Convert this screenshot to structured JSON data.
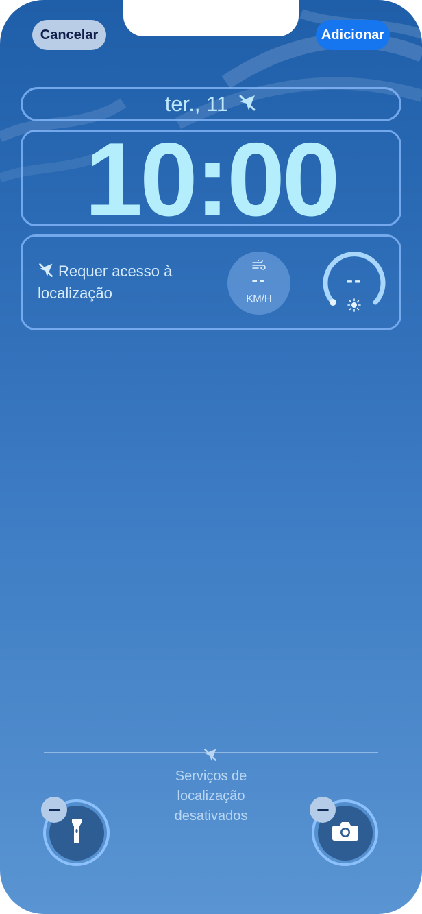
{
  "header": {
    "cancel_label": "Cancelar",
    "add_label": "Adicionar"
  },
  "lock_screen": {
    "date": "ter., 11",
    "time": "10:00"
  },
  "widgets": {
    "location_required": "Requer acesso à localização",
    "wind": {
      "value": "--",
      "unit": "KM/H"
    },
    "uv_gauge": {
      "value": "--"
    }
  },
  "bottom": {
    "location_services_text": "Serviços de localização desativados"
  },
  "icons": {
    "location_off": "location-slash-icon",
    "wind": "wind-icon",
    "sun": "sun-icon",
    "flashlight": "flashlight-icon",
    "camera": "camera-icon",
    "remove": "minus-icon"
  },
  "colors": {
    "accent_blue": "#1576f0",
    "cancel_bg": "#b9cde6",
    "time_text": "#b4eefc"
  }
}
